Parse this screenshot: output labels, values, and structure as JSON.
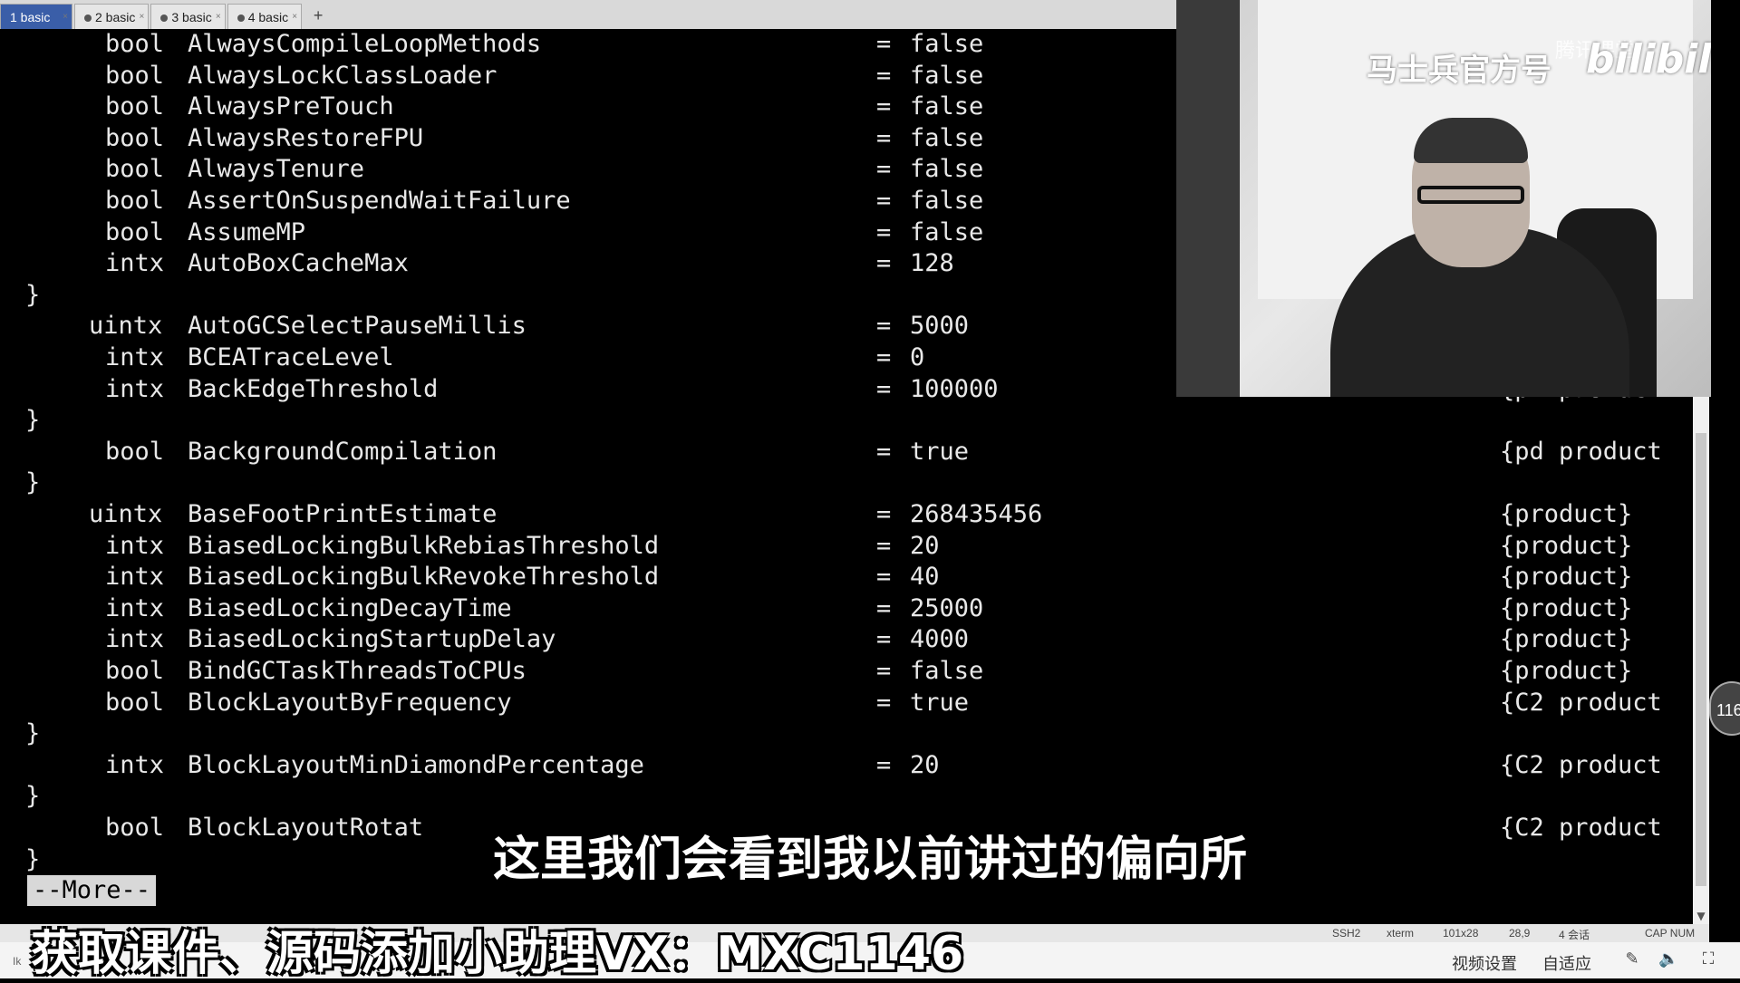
{
  "tabs": [
    {
      "label": "1 basic",
      "active": true
    },
    {
      "label": "2 basic",
      "active": false
    },
    {
      "label": "3 basic",
      "active": false
    },
    {
      "label": "4 basic",
      "active": false
    }
  ],
  "tab_add": "+",
  "terminal": {
    "rows": [
      {
        "kind": "flag",
        "type": "bool",
        "name": "AlwaysCompileLoopMethods",
        "eq": "=",
        "value": "false",
        "cat": ""
      },
      {
        "kind": "flag",
        "type": "bool",
        "name": "AlwaysLockClassLoader",
        "eq": "=",
        "value": "false",
        "cat": ""
      },
      {
        "kind": "flag",
        "type": "bool",
        "name": "AlwaysPreTouch",
        "eq": "=",
        "value": "false",
        "cat": ""
      },
      {
        "kind": "flag",
        "type": "bool",
        "name": "AlwaysRestoreFPU",
        "eq": "=",
        "value": "false",
        "cat": ""
      },
      {
        "kind": "flag",
        "type": "bool",
        "name": "AlwaysTenure",
        "eq": "=",
        "value": "false",
        "cat": ""
      },
      {
        "kind": "flag",
        "type": "bool",
        "name": "AssertOnSuspendWaitFailure",
        "eq": "=",
        "value": "false",
        "cat": ""
      },
      {
        "kind": "flag",
        "type": "bool",
        "name": "AssumeMP",
        "eq": "=",
        "value": "false",
        "cat": ""
      },
      {
        "kind": "flag",
        "type": "intx",
        "name": "AutoBoxCacheMax",
        "eq": "=",
        "value": "128",
        "cat": ""
      },
      {
        "kind": "brace",
        "text": "}"
      },
      {
        "kind": "flag",
        "type": "uintx",
        "name": "AutoGCSelectPauseMillis",
        "eq": "=",
        "value": "5000",
        "cat": ""
      },
      {
        "kind": "flag",
        "type": "intx",
        "name": "BCEATraceLevel",
        "eq": "=",
        "value": "0",
        "cat": ""
      },
      {
        "kind": "flag",
        "type": "intx",
        "name": "BackEdgeThreshold",
        "eq": "=",
        "value": "100000",
        "cat": "{pd product"
      },
      {
        "kind": "brace",
        "text": "}"
      },
      {
        "kind": "flag",
        "type": "bool",
        "name": "BackgroundCompilation",
        "eq": "=",
        "value": "true",
        "cat": "{pd product"
      },
      {
        "kind": "brace",
        "text": "}"
      },
      {
        "kind": "flag",
        "type": "uintx",
        "name": "BaseFootPrintEstimate",
        "eq": "=",
        "value": "268435456",
        "cat": "{product}"
      },
      {
        "kind": "flag",
        "type": "intx",
        "name": "BiasedLockingBulkRebiasThreshold",
        "eq": "=",
        "value": "20",
        "cat": "{product}"
      },
      {
        "kind": "flag",
        "type": "intx",
        "name": "BiasedLockingBulkRevokeThreshold",
        "eq": "=",
        "value": "40",
        "cat": "{product}"
      },
      {
        "kind": "flag",
        "type": "intx",
        "name": "BiasedLockingDecayTime",
        "eq": "=",
        "value": "25000",
        "cat": "{product}"
      },
      {
        "kind": "flag",
        "type": "intx",
        "name": "BiasedLockingStartupDelay",
        "eq": "=",
        "value": "4000",
        "cat": "{product}"
      },
      {
        "kind": "flag",
        "type": "bool",
        "name": "BindGCTaskThreadsToCPUs",
        "eq": "=",
        "value": "false",
        "cat": "{product}"
      },
      {
        "kind": "flag",
        "type": "bool",
        "name": "BlockLayoutByFrequency",
        "eq": "=",
        "value": "true",
        "cat": "{C2 product"
      },
      {
        "kind": "brace",
        "text": "}"
      },
      {
        "kind": "flag",
        "type": "intx",
        "name": "BlockLayoutMinDiamondPercentage",
        "eq": "=",
        "value": "20",
        "cat": "{C2 product"
      },
      {
        "kind": "brace",
        "text": "}"
      },
      {
        "kind": "flag",
        "type": "bool",
        "name": "BlockLayoutRotat",
        "eq": "",
        "value": "",
        "cat": "{C2 product"
      },
      {
        "kind": "brace",
        "text": "}"
      }
    ],
    "more_prompt": "--More--"
  },
  "webcam": {
    "watermark_text": "马士兵官方号",
    "watermark_logo": "bilibili",
    "watermark_small": "腾讯课堂"
  },
  "side_badge": "116",
  "subtitle": "这里我们会看到我以前讲过的偏向所",
  "promo": "获取课件、源码添加小助理VX：MXC1146",
  "statusbar": {
    "ssh": "SSH2",
    "term": "xterm",
    "size": "101x28",
    "pos": "28,9",
    "sessions": "4 会话",
    "caps": "CAP NUM"
  },
  "controls": {
    "left_glyph": "Ik",
    "video_settings": "视频设置",
    "auto_fit": "自适应"
  }
}
